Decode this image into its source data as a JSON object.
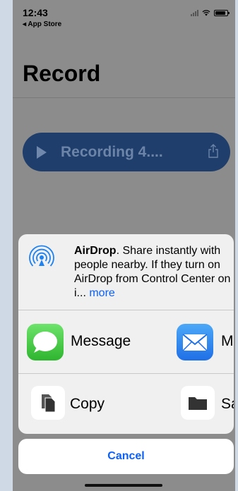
{
  "status_bar": {
    "time": "12:43",
    "back_label": "◂ App Store"
  },
  "page": {
    "title": "Record"
  },
  "recording": {
    "title": "Recording 4...."
  },
  "share_sheet": {
    "airdrop": {
      "title": "AirDrop",
      "description": ". Share instantly with people nearby. If they turn on AirDrop from Control Center on i...",
      "more_label": "more"
    },
    "apps": [
      {
        "label": "Message",
        "icon": "message-icon"
      },
      {
        "label": "M",
        "icon": "mail-icon"
      }
    ],
    "actions": [
      {
        "label": "Copy",
        "icon": "copy-icon"
      },
      {
        "label": "Sa",
        "icon": "folder-icon"
      }
    ],
    "cancel_label": "Cancel"
  },
  "colors": {
    "accent": "#0a60ff",
    "recording_pill": "#1f3e6b",
    "dimmed_background": "#8c8c8c"
  }
}
